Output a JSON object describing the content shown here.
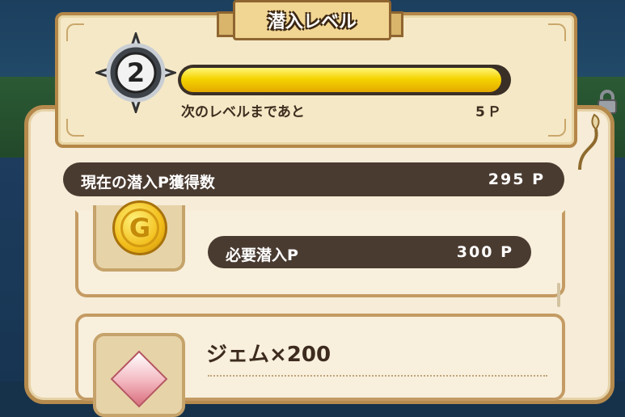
{
  "header": {
    "title": "潜入レベル",
    "level": "2",
    "progress_fraction": 0.98,
    "next_level_label": "次のレベルまであと",
    "next_level_value": "5Ｐ"
  },
  "summary": {
    "current_points_label": "現在の潜入P獲得数",
    "current_points_value": "295 P"
  },
  "rewards": [
    {
      "icon": "gold-coin-icon",
      "required_label": "必要潜入P",
      "required_value": "300 P"
    },
    {
      "icon": "gem-icon",
      "name": "ジェム×200"
    }
  ],
  "colors": {
    "bar_dark": "#4a3b31",
    "progress_yellow": "#f5d400",
    "panel_cream": "#f6ecd7",
    "frame_brown": "#b58a4d"
  }
}
